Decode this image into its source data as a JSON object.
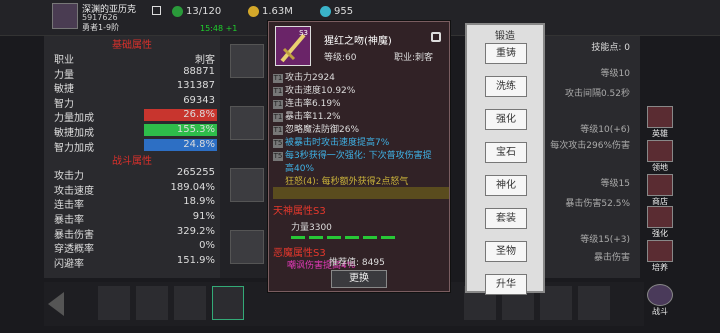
{
  "player": {
    "name": "深渊的亚历克",
    "id": "5917626",
    "rank": "勇者1-9阶",
    "energy": "13/120",
    "gold": "1.63M",
    "gems": "955",
    "timer": "15:48 +1"
  },
  "left_panel": {
    "basic_title": "基础属性",
    "basic": [
      {
        "k": "职业",
        "v": "刺客"
      },
      {
        "k": "力量",
        "v": "88871"
      },
      {
        "k": "敏捷",
        "v": "131387"
      },
      {
        "k": "智力",
        "v": "69343"
      },
      {
        "k": "力量加成",
        "v": "26.8%"
      },
      {
        "k": "敏捷加成",
        "v": "155.3%"
      },
      {
        "k": "智力加成",
        "v": "24.8%"
      }
    ],
    "battle_title": "战斗属性",
    "battle": [
      {
        "k": "攻击力",
        "v": "265255"
      },
      {
        "k": "攻击速度",
        "v": "189.04%"
      },
      {
        "k": "连击率",
        "v": "18.9%"
      },
      {
        "k": "暴击率",
        "v": "91%"
      },
      {
        "k": "暴击伤害",
        "v": "329.2%"
      },
      {
        "k": "穿透概率",
        "v": "0%"
      },
      {
        "k": "闪避率",
        "v": "151.9%"
      }
    ]
  },
  "item": {
    "name": "猩红之吻(神魔)",
    "level": "等级:60",
    "job": "职业:刺客",
    "badge": "S3",
    "lines": [
      {
        "tier": "T1",
        "text": "攻击力2924",
        "color": "#dddddd"
      },
      {
        "tier": "T1",
        "text": "攻击速度10.92%",
        "color": "#dddddd"
      },
      {
        "tier": "T1",
        "text": "连击率6.19%",
        "color": "#dddddd"
      },
      {
        "tier": "T1",
        "text": "暴击率11.2%",
        "color": "#dddddd"
      },
      {
        "tier": "T1",
        "text": "忽略魔法防御26%",
        "color": "#dddddd"
      },
      {
        "tier": "T5",
        "text": "被暴击时攻击速度提高7%",
        "color": "#3fb2e6"
      },
      {
        "tier": "T5",
        "text": "每3秒获得一次强化: 下次普攻伤害提",
        "color": "#3fb2e6"
      },
      {
        "tier": "",
        "text": "高40%",
        "color": "#3fb2e6"
      },
      {
        "tier": "",
        "text": "狂怒(4): 每秒额外获得2点怒气",
        "color": "#c9b23a"
      }
    ],
    "god_title": "天神属性S3",
    "god_stat": "力量3300",
    "demon_title": "恶魔属性S3",
    "demon_stat": "嘲讽伤害提高4%",
    "score": "推荐值: 8495",
    "change_btn": "更换"
  },
  "forge_menu": {
    "title": "锻造",
    "buttons": [
      "重铸",
      "洗练",
      "强化",
      "宝石",
      "神化",
      "套装",
      "圣物",
      "升华"
    ]
  },
  "right_panel": {
    "skill_points": "技能点: 0",
    "rows": [
      "等级10",
      "攻击间隔0.52秒",
      "等级10(+6)",
      "每次攻击296%伤害",
      "等级15",
      "暴击伤害52.5%",
      "等级15(+3)",
      "暴击伤害"
    ]
  },
  "side_buttons": [
    "英雄",
    "领地",
    "商店",
    "强化",
    "培养",
    "战斗"
  ],
  "colors": {
    "red_heading": "#e6382c",
    "bar_red": "#c8352e",
    "bar_green": "#2ebd4a",
    "bar_blue": "#2d6fc4",
    "crimson_bg": "#312226"
  }
}
